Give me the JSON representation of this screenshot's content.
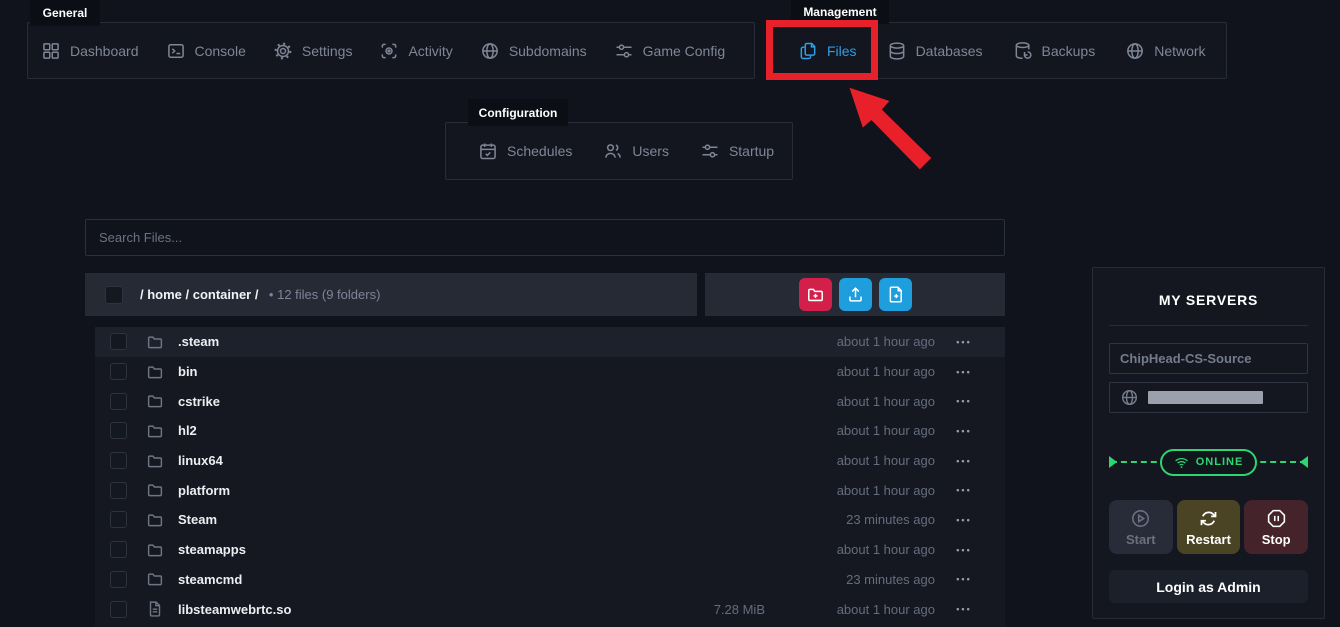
{
  "nav": {
    "general": {
      "label": "General",
      "tabs": [
        {
          "label": "Dashboard"
        },
        {
          "label": "Console"
        },
        {
          "label": "Settings"
        },
        {
          "label": "Activity"
        },
        {
          "label": "Subdomains"
        },
        {
          "label": "Game Config"
        }
      ]
    },
    "management": {
      "label": "Management",
      "tabs": [
        {
          "label": "Files",
          "active": true
        },
        {
          "label": "Databases"
        },
        {
          "label": "Backups"
        },
        {
          "label": "Network"
        }
      ]
    },
    "configuration": {
      "label": "Configuration",
      "tabs": [
        {
          "label": "Schedules"
        },
        {
          "label": "Users"
        },
        {
          "label": "Startup"
        }
      ]
    }
  },
  "annotation": {
    "highlighted_tab": "Files",
    "color": "#e8202a"
  },
  "search": {
    "placeholder": "Search Files..."
  },
  "breadcrumb": {
    "path": "/ home / container /",
    "summary": "• 12 files (9 folders)"
  },
  "files": {
    "rows": [
      {
        "name": ".steam",
        "type": "folder",
        "size": "",
        "modified": "about 1 hour ago"
      },
      {
        "name": "bin",
        "type": "folder",
        "size": "",
        "modified": "about 1 hour ago"
      },
      {
        "name": "cstrike",
        "type": "folder",
        "size": "",
        "modified": "about 1 hour ago"
      },
      {
        "name": "hl2",
        "type": "folder",
        "size": "",
        "modified": "about 1 hour ago"
      },
      {
        "name": "linux64",
        "type": "folder",
        "size": "",
        "modified": "about 1 hour ago"
      },
      {
        "name": "platform",
        "type": "folder",
        "size": "",
        "modified": "about 1 hour ago"
      },
      {
        "name": "Steam",
        "type": "folder",
        "size": "",
        "modified": "23 minutes ago"
      },
      {
        "name": "steamapps",
        "type": "folder",
        "size": "",
        "modified": "about 1 hour ago"
      },
      {
        "name": "steamcmd",
        "type": "folder",
        "size": "",
        "modified": "23 minutes ago"
      },
      {
        "name": "libsteamwebrtc.so",
        "type": "file",
        "size": "7.28 MiB",
        "modified": "about 1 hour ago"
      }
    ]
  },
  "server_panel": {
    "title": "MY SERVERS",
    "server_name": "ChipHead-CS-Source",
    "status": "ONLINE",
    "buttons": {
      "start": "Start",
      "restart": "Restart",
      "stop": "Stop"
    },
    "admin_button": "Login as Admin"
  },
  "glyphs": {
    "ellipsis": "•••"
  },
  "colors": {
    "accent_blue": "#2e9ee8",
    "annotation_red": "#e8202a",
    "action_red": "#d2204a",
    "action_blue": "#1e9edc",
    "online_green": "#2ed573"
  }
}
